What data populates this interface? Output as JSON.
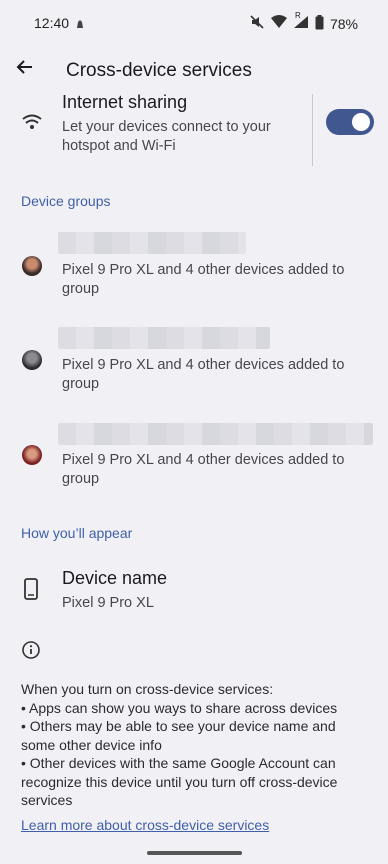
{
  "status_bar": {
    "time": "12:40",
    "battery": "78%",
    "network_label": "R"
  },
  "header": {
    "title": "Cross-device services"
  },
  "internet_sharing": {
    "title": "Internet sharing",
    "description_line1": "Let your devices connect to your",
    "description_line2": "hotspot and Wi-Fi",
    "toggle_on": true
  },
  "device_groups": {
    "heading": "Device groups",
    "items": [
      {
        "line1": "Pixel 9 Pro XL and 4 other devices added to",
        "line2": "group"
      },
      {
        "line1": "Pixel 9 Pro XL and 4 other devices added to",
        "line2": "group"
      },
      {
        "line1": "Pixel 9 Pro XL and 4 other devices added to",
        "line2": "group"
      }
    ]
  },
  "appearance": {
    "heading": "How you’ll appear",
    "device_name_title": "Device name",
    "device_name_value": "Pixel 9 Pro XL"
  },
  "info": {
    "lines": [
      "When you turn on cross-device services:",
      "• Apps can show you ways to share across devices",
      "• Others may be able to see your device name and",
      "some other device info",
      "• Other devices with the same Google Account can",
      "recognize this device until you turn off cross-device",
      "services"
    ],
    "link": "Learn more about cross-device services"
  },
  "colors": {
    "accent": "#3f5fa8",
    "toggle": "#40578f",
    "background": "#f1f1f5"
  }
}
